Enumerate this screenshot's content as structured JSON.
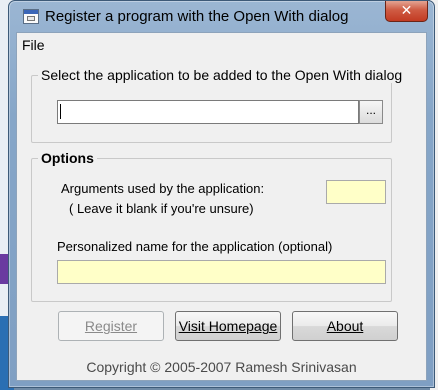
{
  "window": {
    "title": "Register a program with the Open With dialog",
    "close_glyph": "✕"
  },
  "menu": {
    "file_label": "File"
  },
  "application_group": {
    "legend": "Select the application to be added to the Open With dialog",
    "path_value": "",
    "browse_label": "..."
  },
  "options_group": {
    "legend": "Options",
    "arguments_label": "Arguments used by the application:",
    "arguments_hint": "( Leave it blank if you're unsure)",
    "arguments_value": "",
    "name_label": "Personalized name for the application (optional)",
    "name_value": ""
  },
  "buttons": {
    "register": "Register",
    "visit_homepage": "Visit Homepage",
    "about": "About"
  },
  "footer": {
    "copyright": "Copyright © 2005-2007 Ramesh Srinivasan"
  },
  "colors": {
    "input_highlight": "#ffffc8",
    "close_button": "#c23b22"
  }
}
